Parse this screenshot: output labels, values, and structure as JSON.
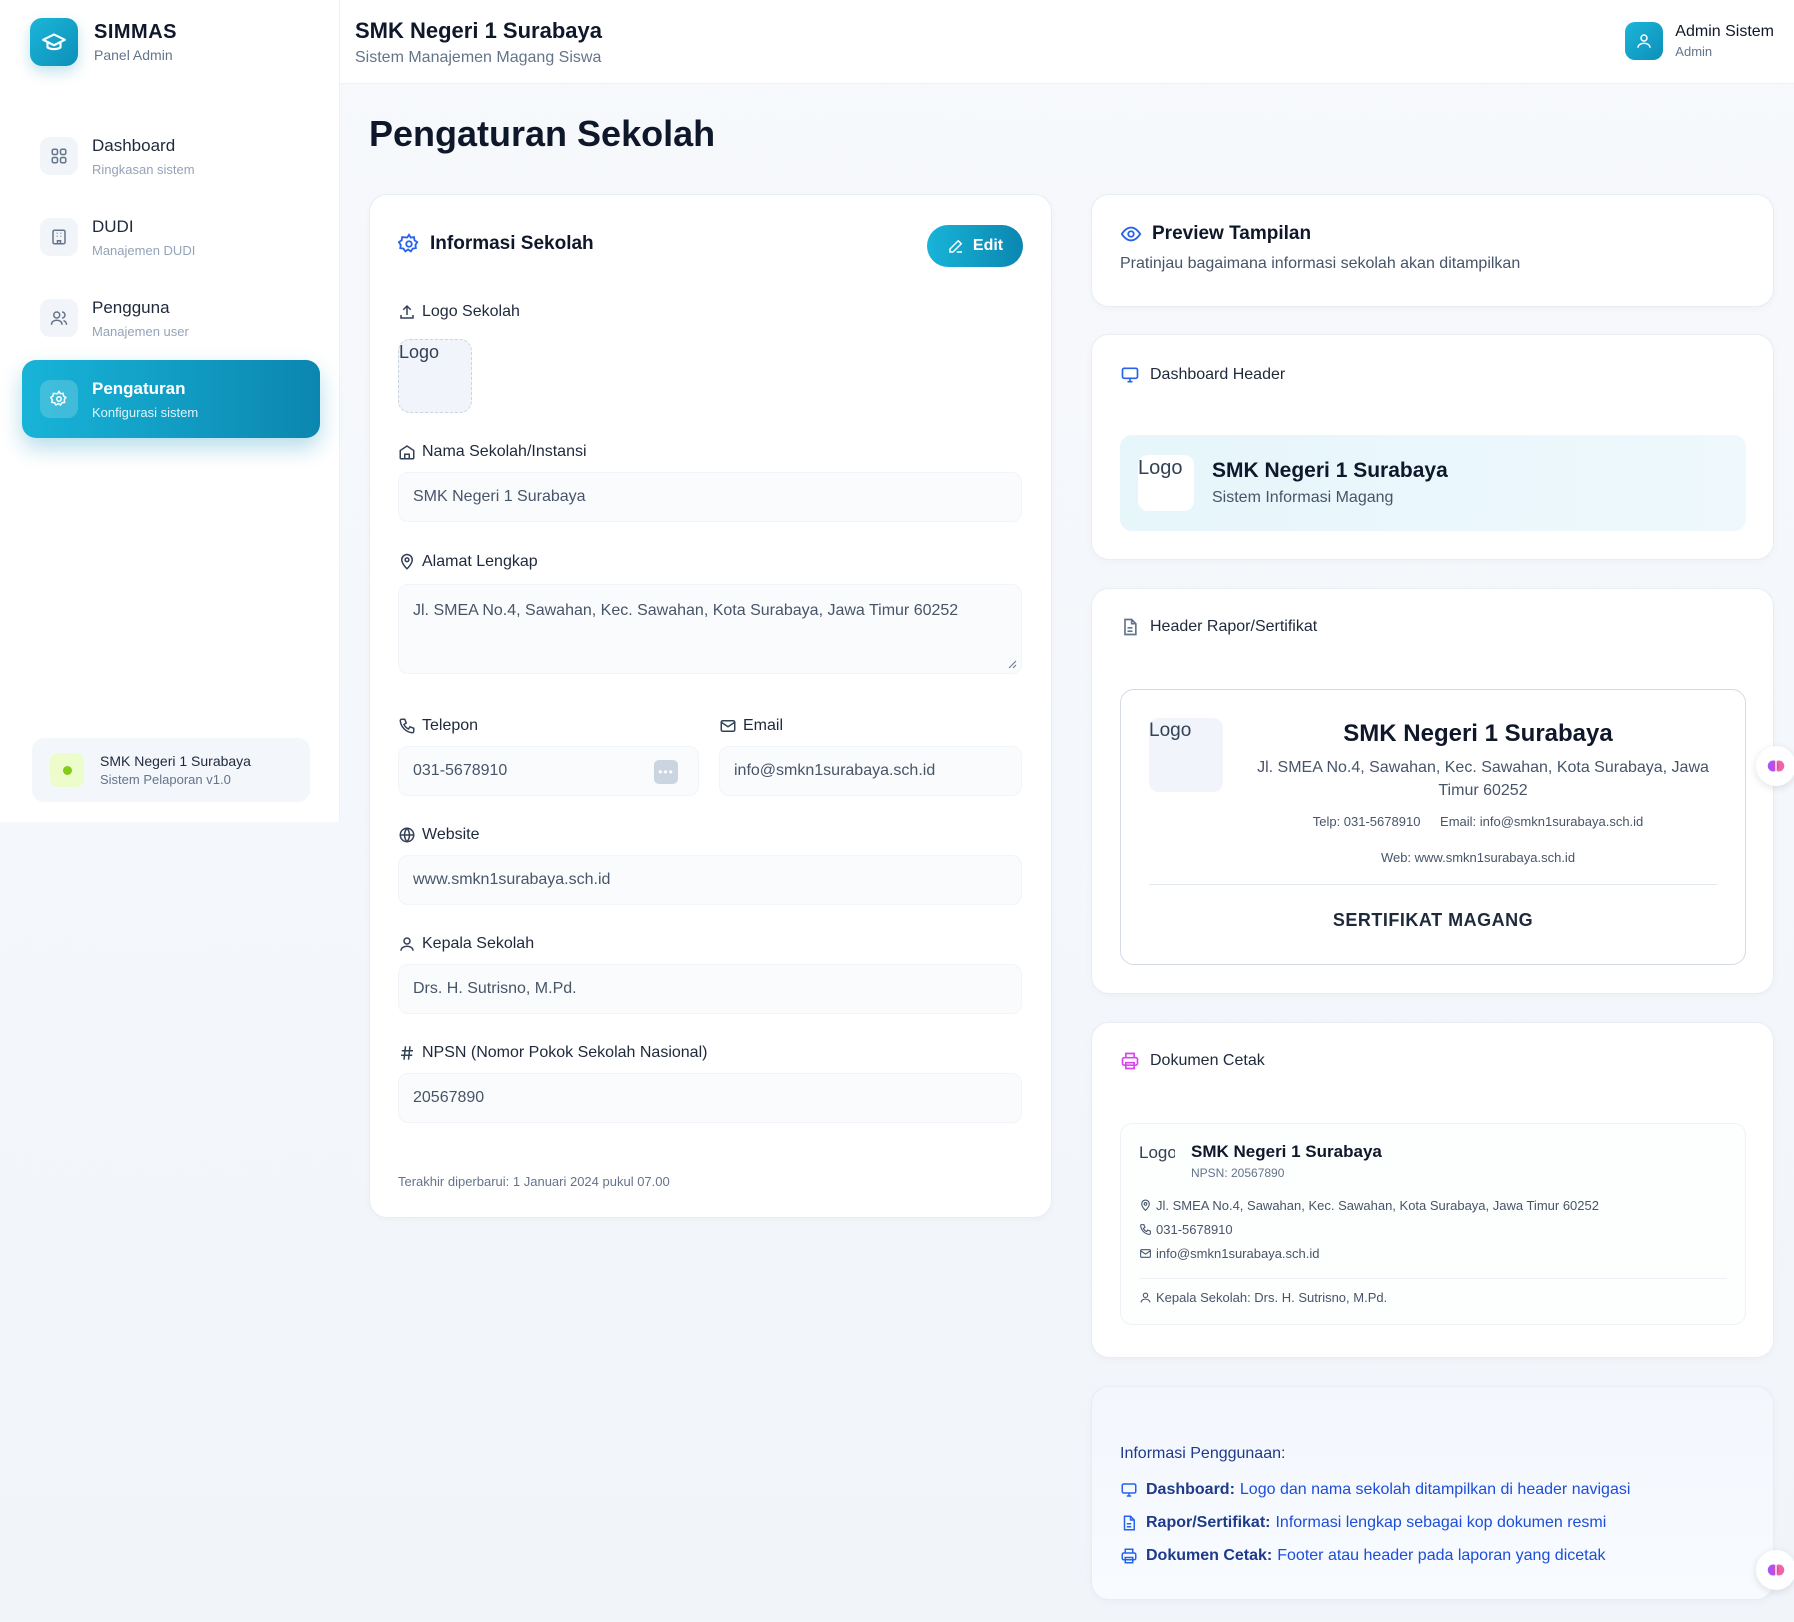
{
  "brand": {
    "title": "SIMMAS",
    "subtitle": "Panel Admin"
  },
  "sidebar": {
    "items": [
      {
        "label": "Dashboard",
        "sub": "Ringkasan sistem",
        "icon": "dashboard-icon"
      },
      {
        "label": "DUDI",
        "sub": "Manajemen DUDI",
        "icon": "building-icon"
      },
      {
        "label": "Pengguna",
        "sub": "Manajemen user",
        "icon": "users-icon"
      },
      {
        "label": "Pengaturan",
        "sub": "Konfigurasi sistem",
        "icon": "settings-icon",
        "active": true
      }
    ],
    "school_card": {
      "title": "SMK Negeri 1 Surabaya",
      "subtitle": "Sistem Pelaporan v1.0"
    }
  },
  "header": {
    "title": "SMK Negeri 1 Surabaya",
    "subtitle": "Sistem Manajemen Magang Siswa",
    "user_name": "Admin Sistem",
    "user_role": "Admin"
  },
  "page": {
    "title": "Pengaturan Sekolah"
  },
  "form": {
    "heading": "Informasi Sekolah",
    "edit_label": "Edit",
    "logo_label": "Logo Sekolah",
    "logo_alt": "Logo",
    "name_label": "Nama Sekolah/Instansi",
    "name_value": "SMK Negeri 1 Surabaya",
    "address_label": "Alamat Lengkap",
    "address_value": "Jl. SMEA No.4, Sawahan, Kec. Sawahan, Kota Surabaya, Jawa Timur 60252",
    "phone_label": "Telepon",
    "phone_value": "031-5678910",
    "email_label": "Email",
    "email_value": "info@smkn1surabaya.sch.id",
    "website_label": "Website",
    "website_value": "www.smkn1surabaya.sch.id",
    "principal_label": "Kepala Sekolah",
    "principal_value": "Drs. H. Sutrisno, M.Pd.",
    "npsn_label": "NPSN (Nomor Pokok Sekolah Nasional)",
    "npsn_value": "20567890",
    "updated": "Terakhir diperbarui: 1 Januari 2024 pukul 07.00"
  },
  "preview": {
    "title": "Preview Tampilan",
    "desc": "Pratinjau bagaimana informasi sekolah akan ditampilkan"
  },
  "dashboard_header": {
    "heading": "Dashboard Header",
    "logo_alt": "Logo",
    "school": "SMK Negeri 1 Surabaya",
    "sub": "Sistem Informasi Magang"
  },
  "rapor": {
    "heading": "Header Rapor/Sertifikat",
    "logo_alt": "Logo",
    "school": "SMK Negeri 1 Surabaya",
    "address": "Jl. SMEA No.4, Sawahan, Kec. Sawahan, Kota Surabaya, Jawa Timur 60252",
    "phone": "Telp: 031-5678910",
    "email": "Email: info@smkn1surabaya.sch.id",
    "web": "Web: www.smkn1surabaya.sch.id",
    "certificate": "SERTIFIKAT MAGANG"
  },
  "dokumen": {
    "heading": "Dokumen Cetak",
    "logo_alt": "Logo",
    "school": "SMK Negeri 1 Surabaya",
    "npsn": "NPSN: 20567890",
    "address": "Jl. SMEA No.4, Sawahan, Kec. Sawahan, Kota Surabaya, Jawa Timur 60252",
    "phone": "031-5678910",
    "email": "info@smkn1surabaya.sch.id",
    "principal": "Kepala Sekolah: Drs. H. Sutrisno, M.Pd."
  },
  "info": {
    "title": "Informasi Penggunaan:",
    "rows": [
      {
        "label": "Dashboard:",
        "desc": "Logo dan nama sekolah ditampilkan di header navigasi"
      },
      {
        "label": "Rapor/Sertifikat:",
        "desc": "Informasi lengkap sebagai kop dokumen resmi"
      },
      {
        "label": "Dokumen Cetak:",
        "desc": "Footer atau header pada laporan yang dicetak"
      }
    ]
  },
  "colors": {
    "accent": "#0e9dc8",
    "accent_dark": "#0b86b0",
    "text": "#0f172a",
    "muted": "#64748b"
  }
}
